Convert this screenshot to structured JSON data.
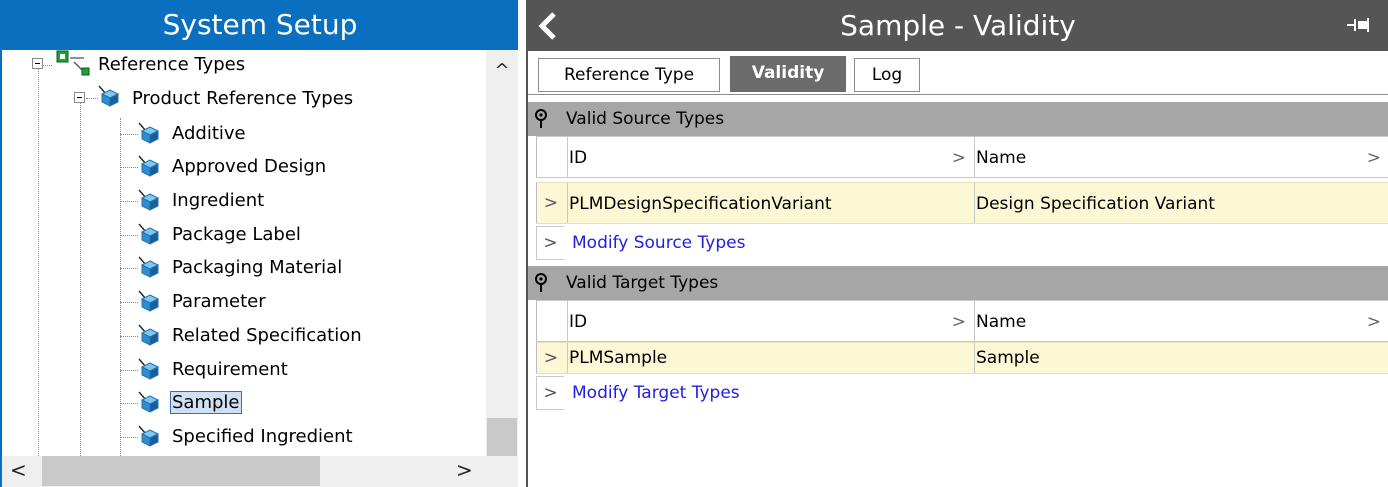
{
  "left_panel": {
    "title": "System Setup",
    "tree": {
      "root_label": "Reference Types",
      "group_label": "Product Reference Types",
      "items": [
        {
          "label": "Additive",
          "selected": false
        },
        {
          "label": "Approved Design",
          "selected": false
        },
        {
          "label": "Ingredient",
          "selected": false
        },
        {
          "label": "Package Label",
          "selected": false
        },
        {
          "label": "Packaging Material",
          "selected": false
        },
        {
          "label": "Parameter",
          "selected": false
        },
        {
          "label": "Related Specification",
          "selected": false
        },
        {
          "label": "Requirement",
          "selected": false
        },
        {
          "label": "Sample",
          "selected": true
        },
        {
          "label": "Specified Ingredient",
          "selected": false
        }
      ]
    },
    "scroll": {
      "up_glyph": "^",
      "left_glyph": "<",
      "right_glyph": ">"
    }
  },
  "right_panel": {
    "title": "Sample - Validity",
    "tabs": [
      {
        "label": "Reference Type",
        "active": false
      },
      {
        "label": "Validity",
        "active": true
      },
      {
        "label": "Log",
        "active": false
      }
    ],
    "source_section": {
      "header": "Valid Source Types",
      "col_id": "ID",
      "col_name": "Name",
      "rows": [
        {
          "id": "PLMDesignSpecificationVariant",
          "name": "Design Specification Variant"
        }
      ],
      "modify_link": "Modify Source Types"
    },
    "target_section": {
      "header": "Valid Target Types",
      "col_id": "ID",
      "col_name": "Name",
      "rows": [
        {
          "id": "PLMSample",
          "name": "Sample"
        }
      ],
      "modify_link": "Modify Target Types"
    },
    "row_glyph": ">"
  },
  "colors": {
    "left_header": "#0a6fbf",
    "right_header": "#555555",
    "section_header": "#a6a6a6",
    "data_row": "#fcf8d6",
    "link": "#2020e0"
  }
}
